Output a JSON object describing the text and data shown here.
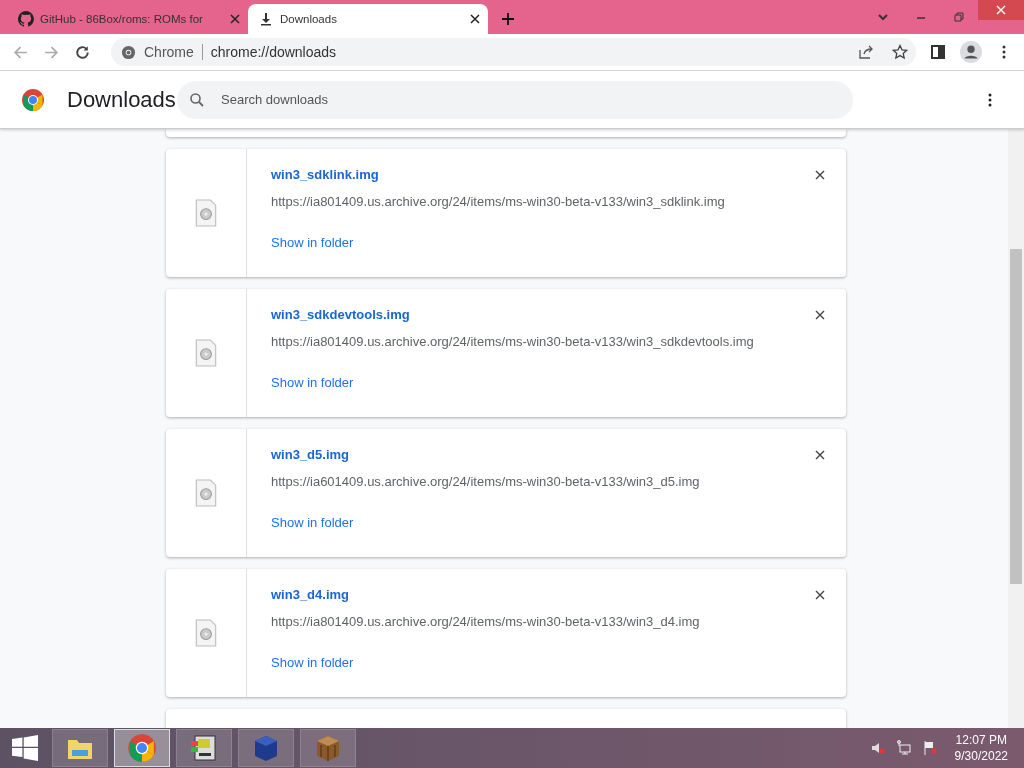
{
  "tabs": [
    {
      "title": "GitHub - 86Box/roms: ROMs for",
      "selected": false,
      "kind": "github"
    },
    {
      "title": "Downloads",
      "selected": true,
      "kind": "download"
    }
  ],
  "address_bar": {
    "site": "Chrome",
    "url": "chrome://downloads"
  },
  "page": {
    "title": "Downloads",
    "search": {
      "placeholder": "Search downloads"
    }
  },
  "downloads": [
    {
      "name": "win3_sdklink.img",
      "url": "https://ia801409.us.archive.org/24/items/ms-win30-beta-v133/win3_sdklink.img",
      "action": "Show in folder"
    },
    {
      "name": "win3_sdkdevtools.img",
      "url": "https://ia801409.us.archive.org/24/items/ms-win30-beta-v133/win3_sdkdevtools.img",
      "action": "Show in folder"
    },
    {
      "name": "win3_d5.img",
      "url": "https://ia601409.us.archive.org/24/items/ms-win30-beta-v133/win3_d5.img",
      "action": "Show in folder"
    },
    {
      "name": "win3_d4.img",
      "url": "https://ia801409.us.archive.org/24/items/ms-win30-beta-v133/win3_d4.img",
      "action": "Show in folder"
    }
  ],
  "taskbar": {
    "apps": [
      {
        "kind": "folder",
        "selected": false
      },
      {
        "kind": "chrome",
        "selected": true
      },
      {
        "kind": "computer",
        "selected": false
      },
      {
        "kind": "cube",
        "selected": false
      },
      {
        "kind": "crate",
        "selected": false
      }
    ],
    "time": "12:07 PM",
    "date": "9/30/2022"
  }
}
